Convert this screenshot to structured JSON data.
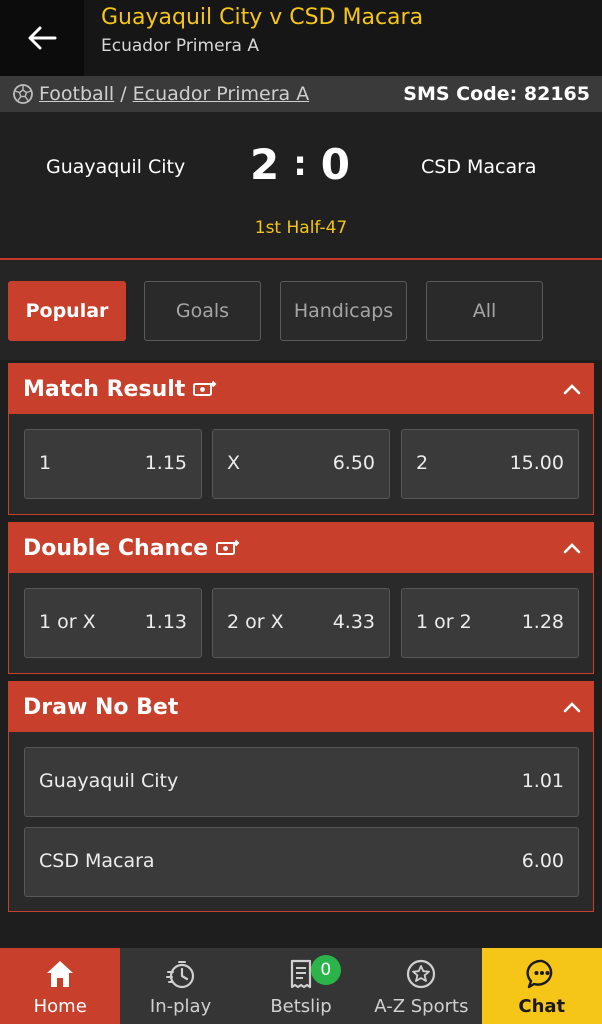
{
  "header": {
    "title": "Guayaquil City v CSD Macara",
    "subtitle": "Ecuador Primera A"
  },
  "breadcrumb": {
    "sport": "Football",
    "separator": "/",
    "league": "Ecuador Primera A",
    "sms_code": "SMS Code: 82165"
  },
  "scoreboard": {
    "home_team": "Guayaquil City",
    "away_team": "CSD Macara",
    "home_score": "2",
    "separator": ":",
    "away_score": "0",
    "period": "1st Half-47"
  },
  "tabs": [
    "Popular",
    "Goals",
    "Handicaps",
    "All"
  ],
  "active_tab": "Popular",
  "markets": {
    "match_result": {
      "title": "Match Result",
      "odds": [
        {
          "label": "1",
          "value": "1.15"
        },
        {
          "label": "X",
          "value": "6.50"
        },
        {
          "label": "2",
          "value": "15.00"
        }
      ]
    },
    "double_chance": {
      "title": "Double Chance",
      "odds": [
        {
          "label": "1 or X",
          "value": "1.13"
        },
        {
          "label": "2 or X",
          "value": "4.33"
        },
        {
          "label": "1 or 2",
          "value": "1.28"
        }
      ]
    },
    "draw_no_bet": {
      "title": "Draw No Bet",
      "odds": [
        {
          "label": "Guayaquil City",
          "value": "1.01"
        },
        {
          "label": "CSD Macara",
          "value": "6.00"
        }
      ]
    }
  },
  "bottom_nav": {
    "home": "Home",
    "inplay": "In-play",
    "betslip": "Betslip",
    "betslip_count": "0",
    "az_sports": "A-Z Sports",
    "chat": "Chat"
  },
  "colors": {
    "accent_red": "#c8402c",
    "accent_yellow": "#f5c518",
    "badge_green": "#2bb44a"
  }
}
